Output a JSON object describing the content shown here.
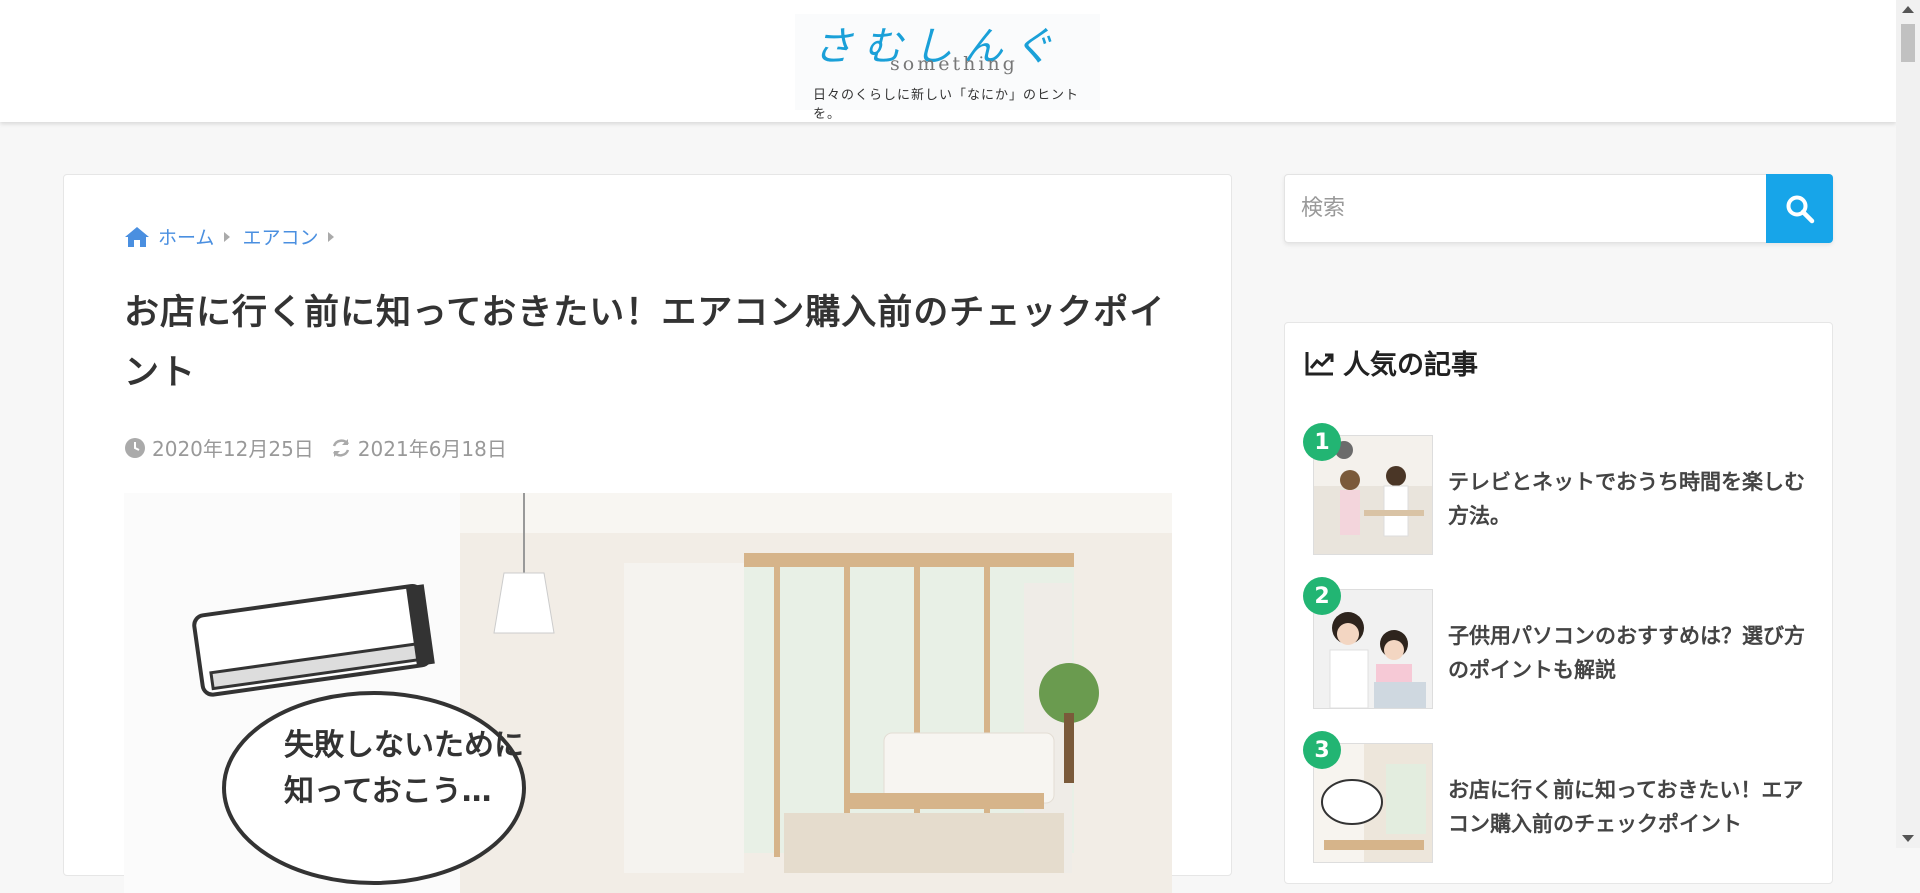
{
  "header": {
    "logo_script": "さむしんぐ",
    "logo_sub": "something",
    "logo_tagline": "日々のくらしに新しい「なにか」のヒントを。"
  },
  "breadcrumb": {
    "home": "ホーム",
    "category": "エアコン"
  },
  "article": {
    "title": "お店に行く前に知っておきたい！エアコン購入前のチェックポイント",
    "published": "2020年12月25日",
    "updated": "2021年6月18日",
    "image_text_line1": "失敗しないために",
    "image_text_line2": "知っておこう…"
  },
  "sidebar": {
    "search_placeholder": "検索",
    "popular_heading": "人気の記事",
    "items": [
      {
        "rank": "1",
        "title": "テレビとネットでおうち時間を楽しむ方法。"
      },
      {
        "rank": "2",
        "title": "子供用パソコンのおすすめは？選び方のポイントも解説"
      },
      {
        "rank": "3",
        "title": "お店に行く前に知っておきたい！エアコン購入前のチェックポイント"
      }
    ]
  },
  "colors": {
    "accent_blue": "#17a5e9",
    "link_blue": "#4a8fe0",
    "rank_green": "#22b573"
  }
}
